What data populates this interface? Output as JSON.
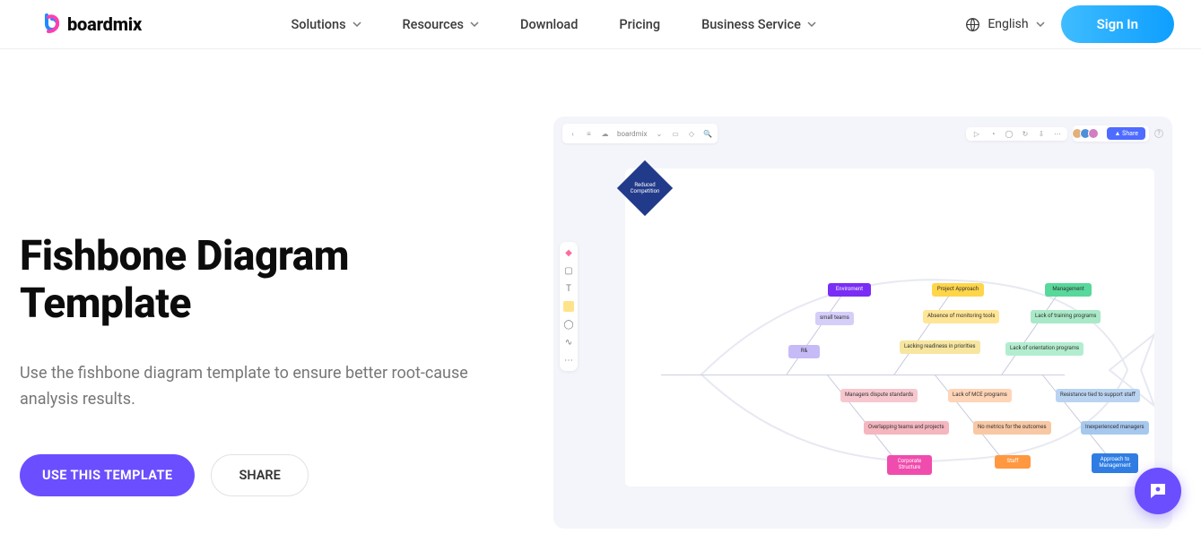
{
  "header": {
    "brand": "boardmix",
    "nav": {
      "solutions": "Solutions",
      "resources": "Resources",
      "download": "Download",
      "pricing": "Pricing",
      "business": "Business Service"
    },
    "language": "English",
    "signin": "Sign In"
  },
  "hero": {
    "title": "Fishbone Diagram Template",
    "description": "Use the fishbone diagram template to ensure better root-cause analysis results.",
    "primary_cta": "USE THIS TEMPLATE",
    "secondary_cta": "SHARE"
  },
  "preview": {
    "doc_title": "boardmix",
    "share": "Share",
    "fish": {
      "head": "Reduced Competition",
      "cat1": "Enviroment",
      "cat2": "Project Approach",
      "cat3": "Management",
      "cat4": "Corporate Structure",
      "cat5": "Staff",
      "cat6": "Approach to Management",
      "n11": "small teams",
      "n12": "R&",
      "n21": "Absence of monitoring tools",
      "n22": "Lacking readiness in priorities",
      "n31": "Lack of training programs",
      "n32": "Lack of orientation programs",
      "n41": "Managers dispute standards",
      "n42": "Overlapping teams and projects",
      "n51": "Lack of MCE programs",
      "n52": "No metrics for the outcomes",
      "n61": "Resistance tied to support staff",
      "n62": "Inexperienced managers"
    }
  }
}
